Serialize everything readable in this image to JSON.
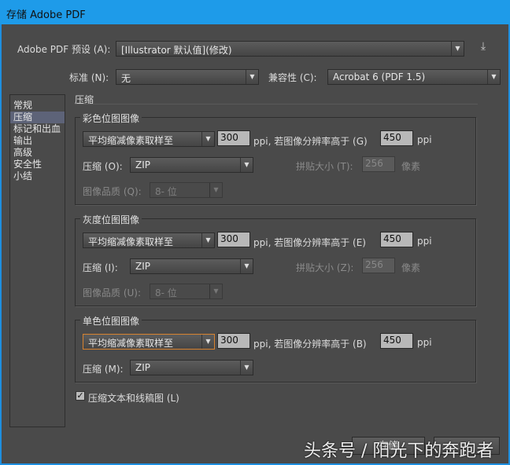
{
  "window": {
    "title": "存储 Adobe PDF"
  },
  "preset": {
    "label": "Adobe PDF 预设 (A):",
    "value": "[Illustrator 默认值](修改)",
    "save_icon": "save-preset-icon"
  },
  "standard": {
    "label": "标准 (N):",
    "value": "无"
  },
  "compat": {
    "label": "兼容性 (C):",
    "value": "Acrobat 6 (PDF 1.5)"
  },
  "sidebar": {
    "items": [
      {
        "label": "常规"
      },
      {
        "label": "压缩",
        "selected": true
      },
      {
        "label": "标记和出血"
      },
      {
        "label": "输出"
      },
      {
        "label": "高级"
      },
      {
        "label": "安全性"
      },
      {
        "label": "小结"
      }
    ]
  },
  "section_title": "压缩",
  "groups": [
    {
      "title": "彩色位图图像",
      "method": "平均缩减像素取样至",
      "ppi": "300",
      "mid_text": "ppi, 若图像分辨率高于 (G)",
      "above": "450",
      "ppi2": "ppi",
      "compress_label": "压缩 (O):",
      "compress": "ZIP",
      "tile_label": "拼贴大小 (T):",
      "tile": "256",
      "tile_unit": "像素",
      "quality_label": "图像品质 (Q):",
      "quality": "8- 位"
    },
    {
      "title": "灰度位图图像",
      "method": "平均缩减像素取样至",
      "ppi": "300",
      "mid_text": "ppi, 若图像分辨率高于 (E)",
      "above": "450",
      "ppi2": "ppi",
      "compress_label": "压缩 (I):",
      "compress": "ZIP",
      "tile_label": "拼贴大小 (Z):",
      "tile": "256",
      "tile_unit": "像素",
      "quality_label": "图像品质 (U):",
      "quality": "8- 位"
    },
    {
      "title": "单色位图图像",
      "method": "平均缩减像素取样至",
      "ppi": "300",
      "mid_text": "ppi, 若图像分辨率高于 (B)",
      "above": "450",
      "ppi2": "ppi",
      "compress_label": "压缩 (M):",
      "compress": "ZIP"
    }
  ],
  "checkbox": {
    "label": "压缩文本和线稿图 (L)",
    "checked": true
  },
  "buttons": {
    "save": "存储",
    "cancel": ""
  },
  "watermark": "头条号 / 阳光下的奔跑者",
  "colors": {
    "titlebar": "#1e9be9",
    "background": "#4a4a4a",
    "selected": "#5d6378",
    "focus": "#d7822f"
  }
}
